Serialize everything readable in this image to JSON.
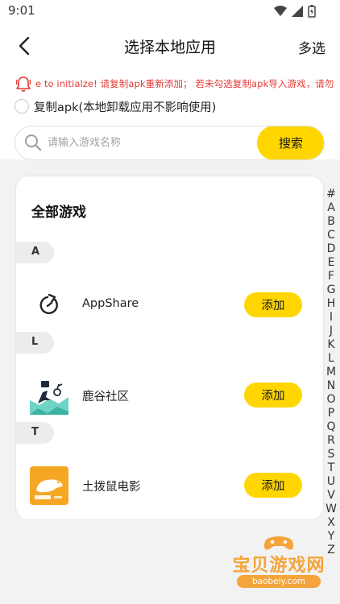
{
  "status_bar": {
    "time": "9:01"
  },
  "nav": {
    "title": "选择本地应用",
    "right_action": "多选"
  },
  "notice": {
    "text": "e to initialze! 请复制apk重新添加； 若未勾选复制apk导入游戏，请勿"
  },
  "copy_option": {
    "label": "复制apk(本地卸载应用不影响使用)",
    "checked": false
  },
  "search": {
    "placeholder": "请输入游戏名称",
    "value": "",
    "button_label": "搜索"
  },
  "list": {
    "title": "全部游戏",
    "sections": [
      {
        "letter": "A",
        "apps": [
          {
            "name": "AppShare",
            "icon": "appshare-icon",
            "action": "添加"
          }
        ]
      },
      {
        "letter": "L",
        "apps": [
          {
            "name": "鹿谷社区",
            "icon": "lugu-community-icon",
            "action": "添加"
          }
        ]
      },
      {
        "letter": "T",
        "apps": [
          {
            "name": "土拨鼠电影",
            "icon": "groundhog-movie-icon",
            "action": "添加"
          }
        ]
      }
    ]
  },
  "alphabet_index": [
    "#",
    "A",
    "B",
    "C",
    "D",
    "E",
    "F",
    "G",
    "H",
    "I",
    "J",
    "K",
    "L",
    "M",
    "N",
    "O",
    "P",
    "Q",
    "R",
    "S",
    "T",
    "U",
    "V",
    "W",
    "X",
    "Y",
    "Z"
  ],
  "watermark": {
    "text": "宝贝游戏网",
    "url": "baobeiy.com"
  },
  "colors": {
    "accent": "#ffd600",
    "notice": "#e53935",
    "background": "#f2f2f2"
  }
}
